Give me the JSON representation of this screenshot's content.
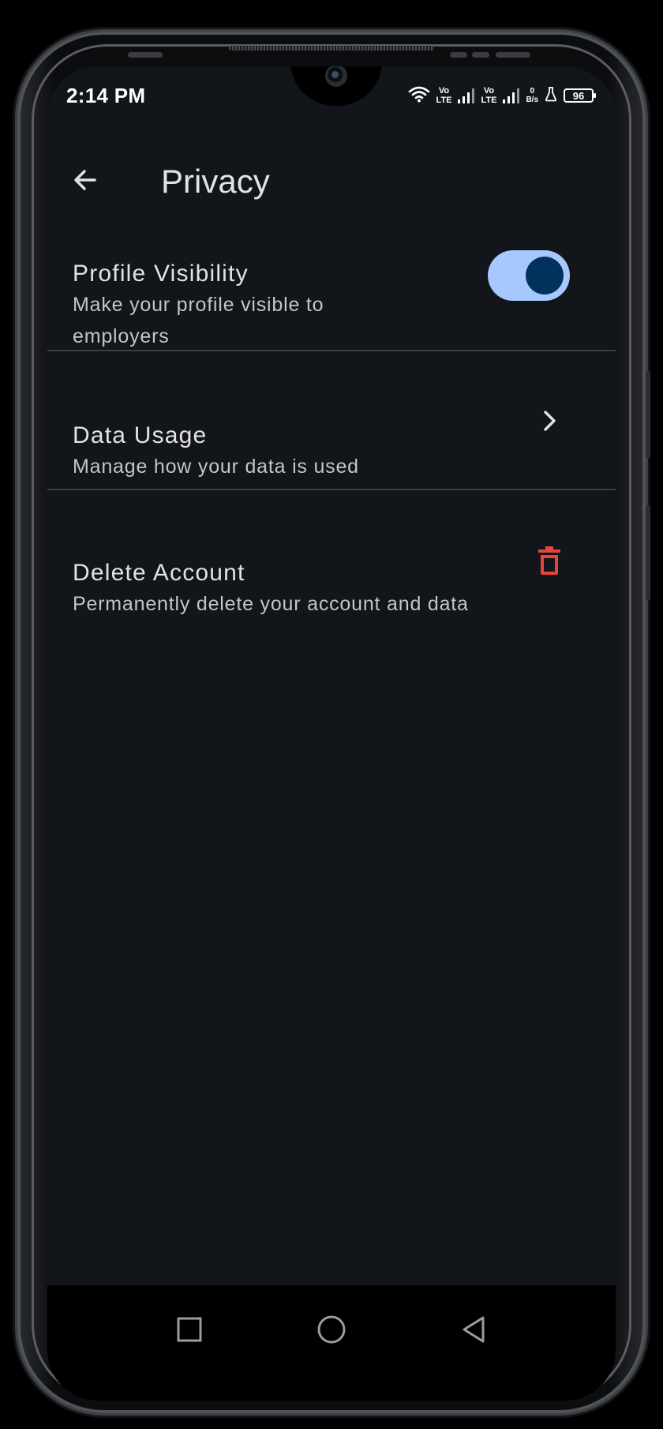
{
  "status_bar": {
    "time": "2:14 PM",
    "network_1": {
      "top": "Vo",
      "bottom": "LTE"
    },
    "network_2": {
      "top": "Vo",
      "bottom": "LTE"
    },
    "net_speed": {
      "value": "0",
      "unit": "B/s"
    },
    "battery": "96",
    "icons": [
      "wifi-icon",
      "signal-icon",
      "signal-icon",
      "flask-icon",
      "battery-icon"
    ]
  },
  "app_bar": {
    "title": "Privacy",
    "back_icon": "arrow-back-icon"
  },
  "settings": {
    "profile_visibility": {
      "title": "Profile Visibility",
      "subtitle": "Make your profile visible to employers",
      "enabled": true
    },
    "data_usage": {
      "title": "Data Usage",
      "subtitle": "Manage how your data is used",
      "icon": "chevron-right-icon"
    },
    "delete_account": {
      "title": "Delete Account",
      "subtitle": "Permanently delete your account and data",
      "icon": "trash-icon"
    }
  },
  "nav_bar": {
    "icons": [
      "recents-square-icon",
      "home-circle-icon",
      "back-triangle-icon"
    ]
  },
  "colors": {
    "background": "#12151a",
    "toggle_track": "#a6c8ff",
    "toggle_knob": "#00325b",
    "danger": "#e5453b",
    "text_primary": "#e3e3e6",
    "text_secondary": "#c2c5cb"
  }
}
